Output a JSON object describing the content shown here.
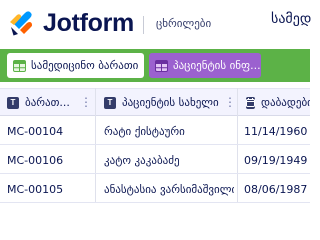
{
  "header": {
    "brand": "Jotform",
    "crumb": "ცხრილები",
    "title": "სამედ"
  },
  "tabs": [
    {
      "label": "სამედიცინო ბარათი",
      "active": true
    },
    {
      "label": "პაციენტის ინფ...",
      "active": false
    }
  ],
  "table": {
    "columns": [
      {
        "label": "ბარათ...",
        "type_badge": "T"
      },
      {
        "label": "პაციენტის სახელი",
        "type_badge": "T"
      },
      {
        "label": "დაბადების",
        "type_badge": "calendar"
      }
    ],
    "rows": [
      [
        "MC-00104",
        "რატი ქისტაური",
        "11/14/1960"
      ],
      [
        "MC-00106",
        "კატო კაკაბაძე",
        "09/19/1949"
      ],
      [
        "MC-00105",
        "ანასტასია ვარსიმაშვილი",
        "08/06/1987"
      ]
    ]
  },
  "colors": {
    "brand_navy": "#0a1551",
    "tabbar_green": "#5cb247",
    "tab_purple": "#9b61cf",
    "header_bg": "#f3f3fe"
  }
}
